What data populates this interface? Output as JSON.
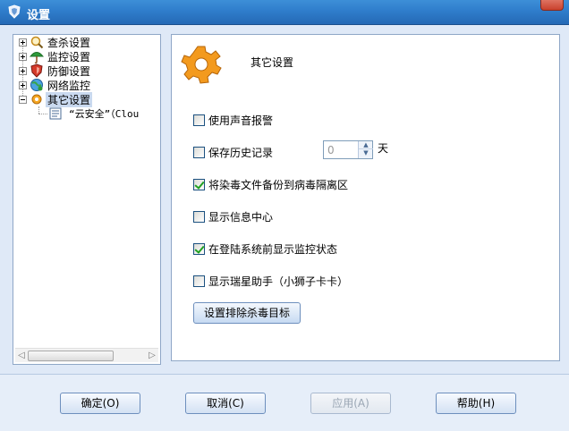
{
  "window": {
    "title": "设置"
  },
  "tree": {
    "items": [
      {
        "label": "查杀设置",
        "icon": "scan-icon"
      },
      {
        "label": "监控设置",
        "icon": "umbrella-icon"
      },
      {
        "label": "防御设置",
        "icon": "shield-icon"
      },
      {
        "label": "网络监控",
        "icon": "globe-icon"
      },
      {
        "label": "其它设置",
        "icon": "gear-icon",
        "selected": true
      }
    ],
    "child": {
      "label": "“云安全”（Clou",
      "icon": "document-icon"
    }
  },
  "panel": {
    "title": "其它设置",
    "options": [
      {
        "label": "使用声音报警",
        "checked": false
      },
      {
        "label": "保存历史记录",
        "checked": false
      },
      {
        "label": "将染毒文件备份到病毒隔离区",
        "checked": true
      },
      {
        "label": "显示信息中心",
        "checked": false
      },
      {
        "label": "在登陆系统前显示监控状态",
        "checked": true
      },
      {
        "label": "显示瑞星助手（小狮子卡卡）",
        "checked": false
      }
    ],
    "history_days": "0",
    "history_unit": "天",
    "exclude_button": "设置排除杀毒目标"
  },
  "footer": {
    "ok": "确定(O)",
    "cancel": "取消(C)",
    "apply": "应用(A)",
    "help": "帮助(H)"
  },
  "colors": {
    "titlebar": "#2f7dcb",
    "client_bg": "#dfe9f7",
    "panel_border": "#8fa7c7",
    "check_green": "#21a121"
  }
}
